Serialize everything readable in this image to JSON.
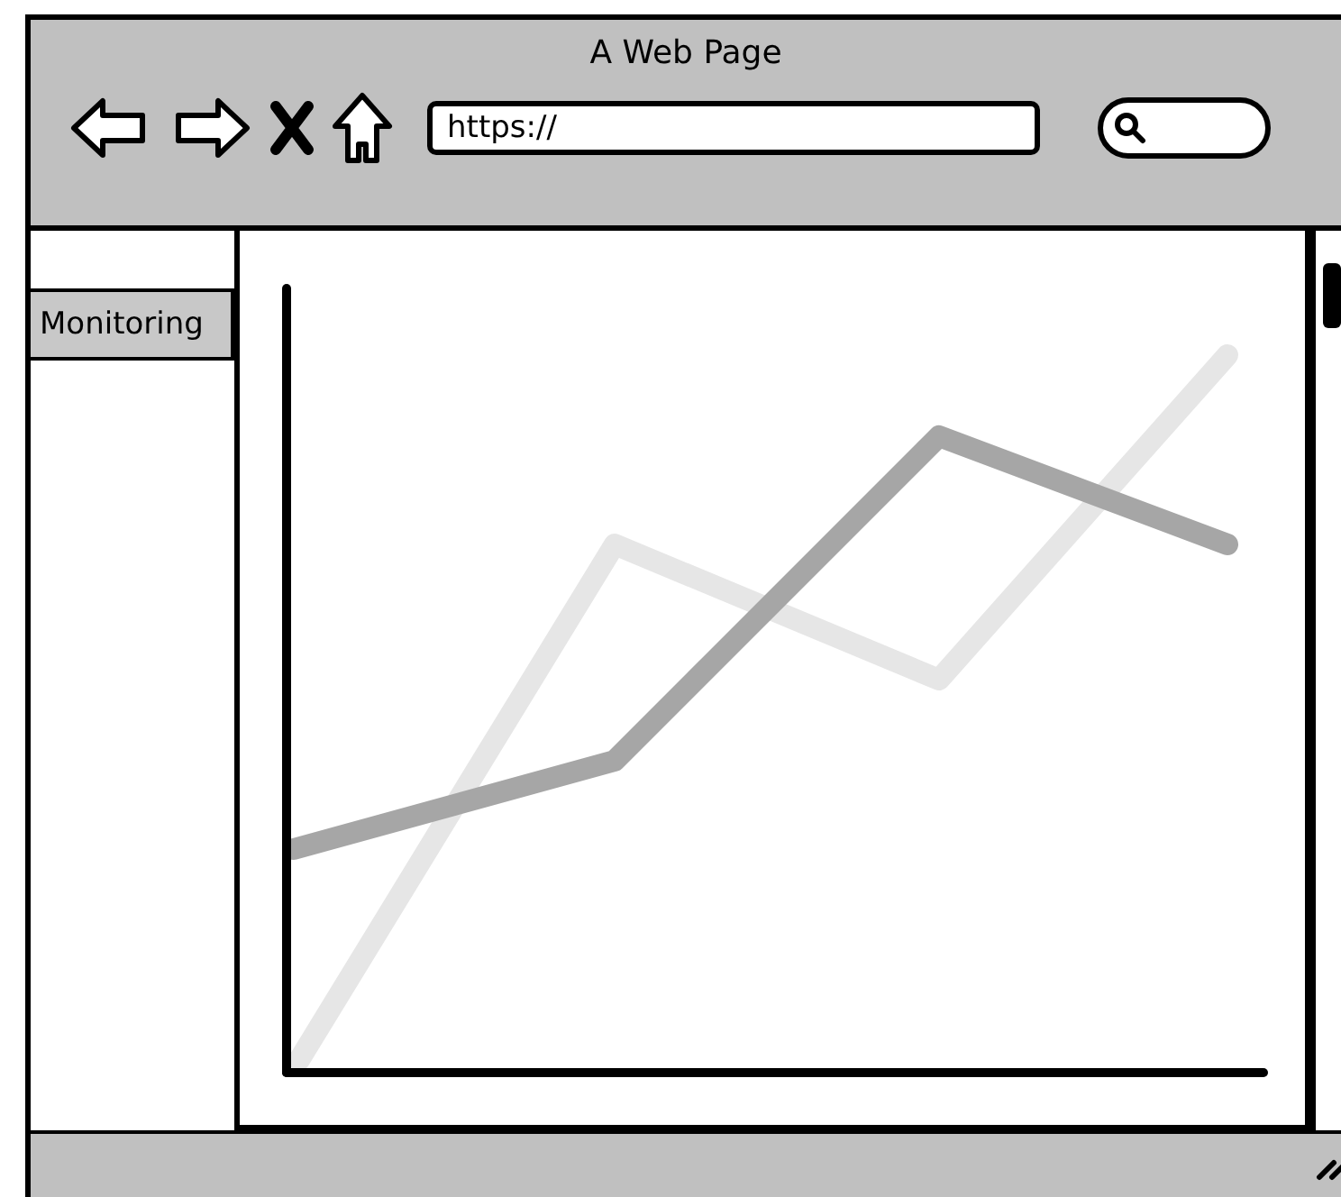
{
  "window": {
    "title": "A Web Page"
  },
  "address_bar": {
    "value": "https://"
  },
  "sidebar": {
    "tabs": [
      {
        "label": "Monitoring"
      }
    ]
  }
}
